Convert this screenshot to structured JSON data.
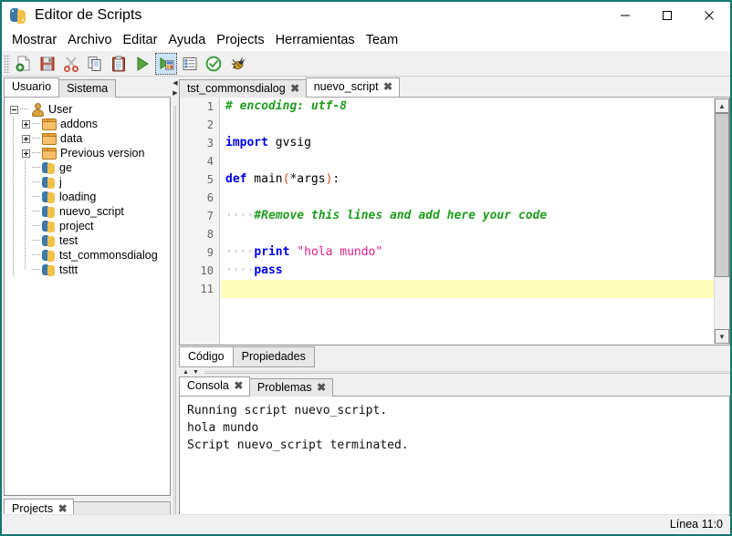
{
  "window": {
    "title": "Editor de Scripts",
    "icon": "python-icon",
    "controls": [
      {
        "name": "minimize-button",
        "glyph": "minimize-icon"
      },
      {
        "name": "maximize-button",
        "glyph": "maximize-icon"
      },
      {
        "name": "close-button",
        "glyph": "close-icon"
      }
    ]
  },
  "menubar": {
    "items": [
      {
        "label": "Mostrar"
      },
      {
        "label": "Archivo"
      },
      {
        "label": "Editar"
      },
      {
        "label": "Ayuda"
      },
      {
        "label": "Projects"
      },
      {
        "label": "Herramientas"
      },
      {
        "label": "Team"
      }
    ]
  },
  "toolbar": {
    "buttons": [
      {
        "name": "new-script-button",
        "icon": "new-file-icon",
        "selected": false
      },
      {
        "name": "save-button",
        "icon": "floppy-save-icon",
        "selected": false
      },
      {
        "name": "cut-button",
        "icon": "scissors-icon",
        "selected": false
      },
      {
        "name": "copy-button",
        "icon": "copy-icon",
        "selected": false
      },
      {
        "name": "paste-button",
        "icon": "clipboard-paste-icon",
        "selected": false
      },
      {
        "name": "run-button",
        "icon": "play-triangle-icon",
        "selected": false
      },
      {
        "name": "run-script-button",
        "icon": "run-script-icon",
        "selected": true
      },
      {
        "name": "properties-button",
        "icon": "list-properties-icon",
        "selected": false
      },
      {
        "name": "check-button",
        "icon": "green-check-icon",
        "selected": false
      },
      {
        "name": "debug-button",
        "icon": "bug-icon",
        "selected": false
      }
    ]
  },
  "left_panel": {
    "tabs": [
      {
        "label": "Usuario",
        "active": true
      },
      {
        "label": "Sistema",
        "active": false
      }
    ],
    "tree": [
      {
        "label": "User",
        "depth": 0,
        "icon": "user-icon",
        "expander": "minus"
      },
      {
        "label": "addons",
        "depth": 1,
        "icon": "folder-icon",
        "expander": "plus"
      },
      {
        "label": "data",
        "depth": 1,
        "icon": "folder-icon",
        "expander": "plus"
      },
      {
        "label": "Previous version",
        "depth": 1,
        "icon": "folder-icon",
        "expander": "plus"
      },
      {
        "label": "ge",
        "depth": 1,
        "icon": "python-file-icon",
        "expander": "none"
      },
      {
        "label": "j",
        "depth": 1,
        "icon": "python-file-icon",
        "expander": "none"
      },
      {
        "label": "loading",
        "depth": 1,
        "icon": "python-file-icon",
        "expander": "none"
      },
      {
        "label": "nuevo_script",
        "depth": 1,
        "icon": "python-file-icon",
        "expander": "none"
      },
      {
        "label": "project",
        "depth": 1,
        "icon": "python-file-icon",
        "expander": "none"
      },
      {
        "label": "test",
        "depth": 1,
        "icon": "python-file-icon",
        "expander": "none"
      },
      {
        "label": "tst_commonsdialog",
        "depth": 1,
        "icon": "python-file-icon",
        "expander": "none"
      },
      {
        "label": "tsttt",
        "depth": 1,
        "icon": "python-file-icon",
        "expander": "none"
      }
    ],
    "bottom_tab": {
      "label": "Projects",
      "close": "close-icon"
    }
  },
  "editor": {
    "tabs": [
      {
        "label": "tst_commonsdialog",
        "active": false,
        "close": "close-icon"
      },
      {
        "label": "nuevo_script",
        "active": true,
        "close": "close-icon"
      }
    ],
    "line_numbers": [
      "1",
      "2",
      "3",
      "4",
      "5",
      "6",
      "7",
      "8",
      "9",
      "10",
      "11"
    ],
    "current_line": 11,
    "lines": [
      {
        "n": 1,
        "tokens": [
          {
            "t": "# encoding: utf-8",
            "c": "cm"
          }
        ]
      },
      {
        "n": 2,
        "tokens": []
      },
      {
        "n": 3,
        "tokens": [
          {
            "t": "import",
            "c": "k"
          },
          {
            "t": " gvsig",
            "c": "pl"
          }
        ]
      },
      {
        "n": 4,
        "tokens": []
      },
      {
        "n": 5,
        "tokens": [
          {
            "t": "def",
            "c": "k"
          },
          {
            "t": " main",
            "c": "pl"
          },
          {
            "t": "(",
            "c": "pn"
          },
          {
            "t": "*args",
            "c": "pl"
          },
          {
            "t": ")",
            "c": "pn"
          },
          {
            "t": ":",
            "c": "pl"
          }
        ]
      },
      {
        "n": 6,
        "tokens": []
      },
      {
        "n": 7,
        "tokens": [
          {
            "t": "    ",
            "c": "dot"
          },
          {
            "t": "#Remove this lines and add here your code",
            "c": "cm"
          }
        ]
      },
      {
        "n": 8,
        "tokens": []
      },
      {
        "n": 9,
        "tokens": [
          {
            "t": "    ",
            "c": "dot"
          },
          {
            "t": "print",
            "c": "k"
          },
          {
            "t": " ",
            "c": "pl"
          },
          {
            "t": "\"hola mundo\"",
            "c": "st"
          }
        ]
      },
      {
        "n": 10,
        "tokens": [
          {
            "t": "    ",
            "c": "dot"
          },
          {
            "t": "pass",
            "c": "k"
          }
        ]
      },
      {
        "n": 11,
        "tokens": []
      }
    ],
    "scrollbar": {
      "up": "scroll-up-icon",
      "down": "scroll-down-icon"
    },
    "bottom_tabs": [
      {
        "label": "Código",
        "active": true
      },
      {
        "label": "Propiedades",
        "active": false
      }
    ]
  },
  "console": {
    "tabs": [
      {
        "label": "Consola",
        "active": true,
        "close": "close-icon"
      },
      {
        "label": "Problemas",
        "active": false,
        "close": "close-icon"
      }
    ],
    "output": [
      "Running script nuevo_script.",
      "hola mundo",
      "Script nuevo_script terminated."
    ]
  },
  "statusbar": {
    "position": "Línea 11:0"
  },
  "colors": {
    "window_border": "#12786f",
    "keyword": "#0000e6",
    "comment": "#1f9d1f",
    "string": "#e0208a",
    "paren": "#d04a16",
    "current_line_highlight": "#ffffbb",
    "toolbar_selected": "#cce4f7"
  }
}
